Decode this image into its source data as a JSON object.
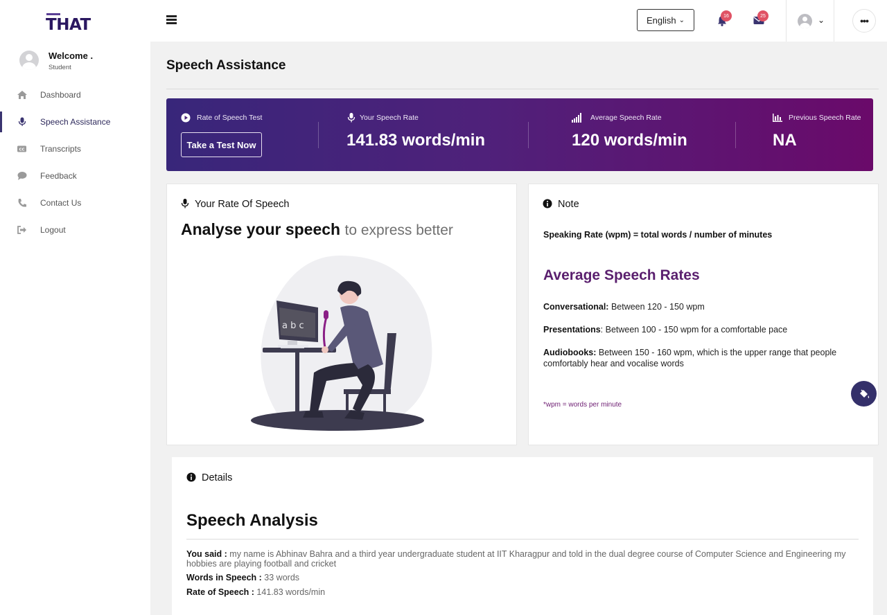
{
  "logo": {
    "text": "THAT"
  },
  "profile": {
    "welcome": "Welcome .",
    "role": "Student"
  },
  "sidebar": {
    "items": [
      {
        "label": "Dashboard",
        "icon": "home-icon"
      },
      {
        "label": "Speech Assistance",
        "icon": "microphone-icon",
        "active": true
      },
      {
        "label": "Transcripts",
        "icon": "closed-captions-icon"
      },
      {
        "label": "Feedback",
        "icon": "speech-bubble-icon"
      },
      {
        "label": "Contact Us",
        "icon": "phone-icon"
      },
      {
        "label": "Logout",
        "icon": "sign-out-icon"
      }
    ]
  },
  "topbar": {
    "language": "English",
    "notifications_count": "16",
    "messages_count": "25"
  },
  "page": {
    "title": "Speech Assistance"
  },
  "banner": {
    "test_label": "Rate of Speech Test",
    "test_button": "Take a Test Now",
    "your_rate_label": "Your Speech Rate",
    "your_rate_value": "141.83 words/min",
    "avg_rate_label": "Average Speech Rate",
    "avg_rate_value": "120 words/min",
    "prev_rate_label": "Previous Speech Rate",
    "prev_rate_value": "NA"
  },
  "rate_card": {
    "heading": "Your Rate Of Speech",
    "hero_bold": "Analyse your speech",
    "hero_light": "to express better",
    "illustration_text": "a b c"
  },
  "note_card": {
    "heading": "Note",
    "formula": "Speaking Rate (wpm) = total words / number of minutes",
    "title": "Average Speech Rates",
    "conversational_label": "Conversational:",
    "conversational_text": " Between 120 - 150 wpm",
    "presentations_label": "Presentations",
    "presentations_text": ": Between 100 - 150 wpm for a comfortable pace",
    "audiobooks_label": "Audiobooks:",
    "audiobooks_text": " Between 150 - 160 wpm, which is the upper range that people comfortably hear and vocalise words",
    "footnote": "*wpm = words per minute"
  },
  "details": {
    "heading": "Details",
    "title": "Speech Analysis",
    "said_label": "You said :",
    "said_text": " my name is Abhinav Bahra and a third year undergraduate student at IIT Kharagpur and told in the dual degree course of Computer Science and Engineering my hobbies are playing football and cricket",
    "words_label": "Words in Speech :",
    "words_text": " 33 words",
    "rate_label": "Rate of Speech :",
    "rate_text": " 141.83 words/min"
  },
  "colors": {
    "brand": "#2a1760",
    "banner_start": "#38267a",
    "banner_end": "#6a0a6a",
    "accent_purple": "#5a1f6e",
    "badge": "#e05265"
  }
}
